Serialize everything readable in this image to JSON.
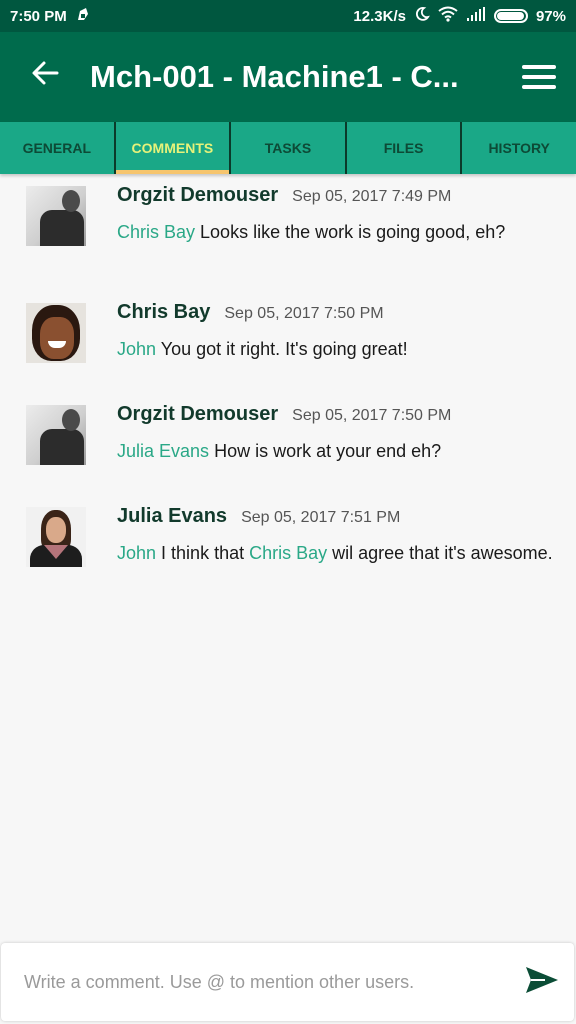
{
  "status_bar": {
    "time": "7:50 PM",
    "network_speed": "12.3K/s",
    "battery": "97%",
    "battery_level": 0.97
  },
  "app_bar": {
    "title": "Mch-001 - Machine1 - C...",
    "back_icon": "arrow-left-icon",
    "menu_icon": "hamburger-menu-icon"
  },
  "tabs": [
    {
      "label": "GENERAL",
      "active": false
    },
    {
      "label": "COMMENTS",
      "active": true
    },
    {
      "label": "TASKS",
      "active": false
    },
    {
      "label": "FILES",
      "active": false
    },
    {
      "label": "HISTORY",
      "active": false
    }
  ],
  "comments": [
    {
      "author": "Orgzit Demouser",
      "time": "Sep 05, 2017 7:49 PM",
      "segments": [
        {
          "mention": "Chris Bay"
        },
        {
          "text": " Looks like the work is going good, eh?"
        }
      ]
    },
    {
      "author": "Chris Bay",
      "time": "Sep 05, 2017 7:50 PM",
      "segments": [
        {
          "mention": "John"
        },
        {
          "text": " You got it right. It's going great!"
        }
      ]
    },
    {
      "author": "Orgzit Demouser",
      "time": "Sep 05, 2017 7:50 PM",
      "segments": [
        {
          "mention": "Julia Evans"
        },
        {
          "text": " How is work at your end eh?"
        }
      ]
    },
    {
      "author": "Julia Evans",
      "time": "Sep 05, 2017 7:51 PM",
      "segments": [
        {
          "mention": "John"
        },
        {
          "text": " I think that "
        },
        {
          "mention": "Chris Bay"
        },
        {
          "text": " wil agree that it's awesome."
        }
      ]
    }
  ],
  "composer": {
    "placeholder": "Write a comment. Use @ to mention other users.",
    "value": "",
    "send_icon": "send-icon"
  },
  "colors": {
    "status_bar": "#00573f",
    "app_bar": "#006b4c",
    "tab_bar": "#1aa887",
    "active_tab_text": "#e6f27a",
    "active_tab_indicator": "#f6c56e",
    "mention": "#2aa887"
  }
}
